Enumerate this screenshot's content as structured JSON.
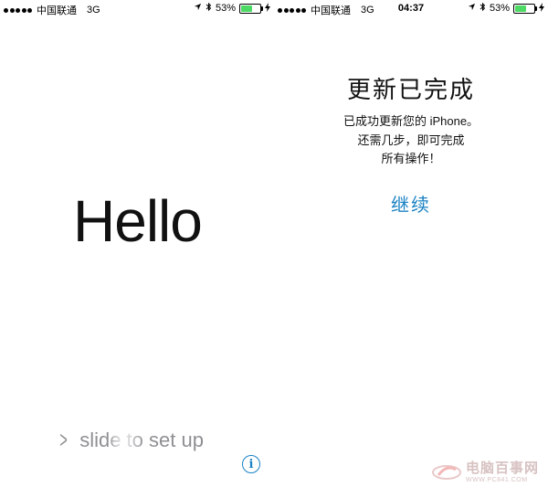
{
  "left_screen": {
    "status_bar": {
      "carrier": "中国联通",
      "network": "3G",
      "battery_percent": "53%",
      "battery_level": 0.53
    },
    "hello_text": "Hello",
    "slide_text": "slide to set up",
    "info_label": "i"
  },
  "right_screen": {
    "status_bar": {
      "carrier": "中国联通",
      "network": "3G",
      "time": "04:37",
      "battery_percent": "53%",
      "battery_level": 0.53
    },
    "title": "更新已完成",
    "line1": "已成功更新您的 iPhone。",
    "line2": "还需几步，即可完成",
    "line3": "所有操作！",
    "continue_label": "继续"
  },
  "watermark": {
    "name": "电脑百事网",
    "url": "WWW.PC841.COM"
  },
  "colors": {
    "accent": "#1a82c4",
    "battery_fill": "#4cd964"
  }
}
